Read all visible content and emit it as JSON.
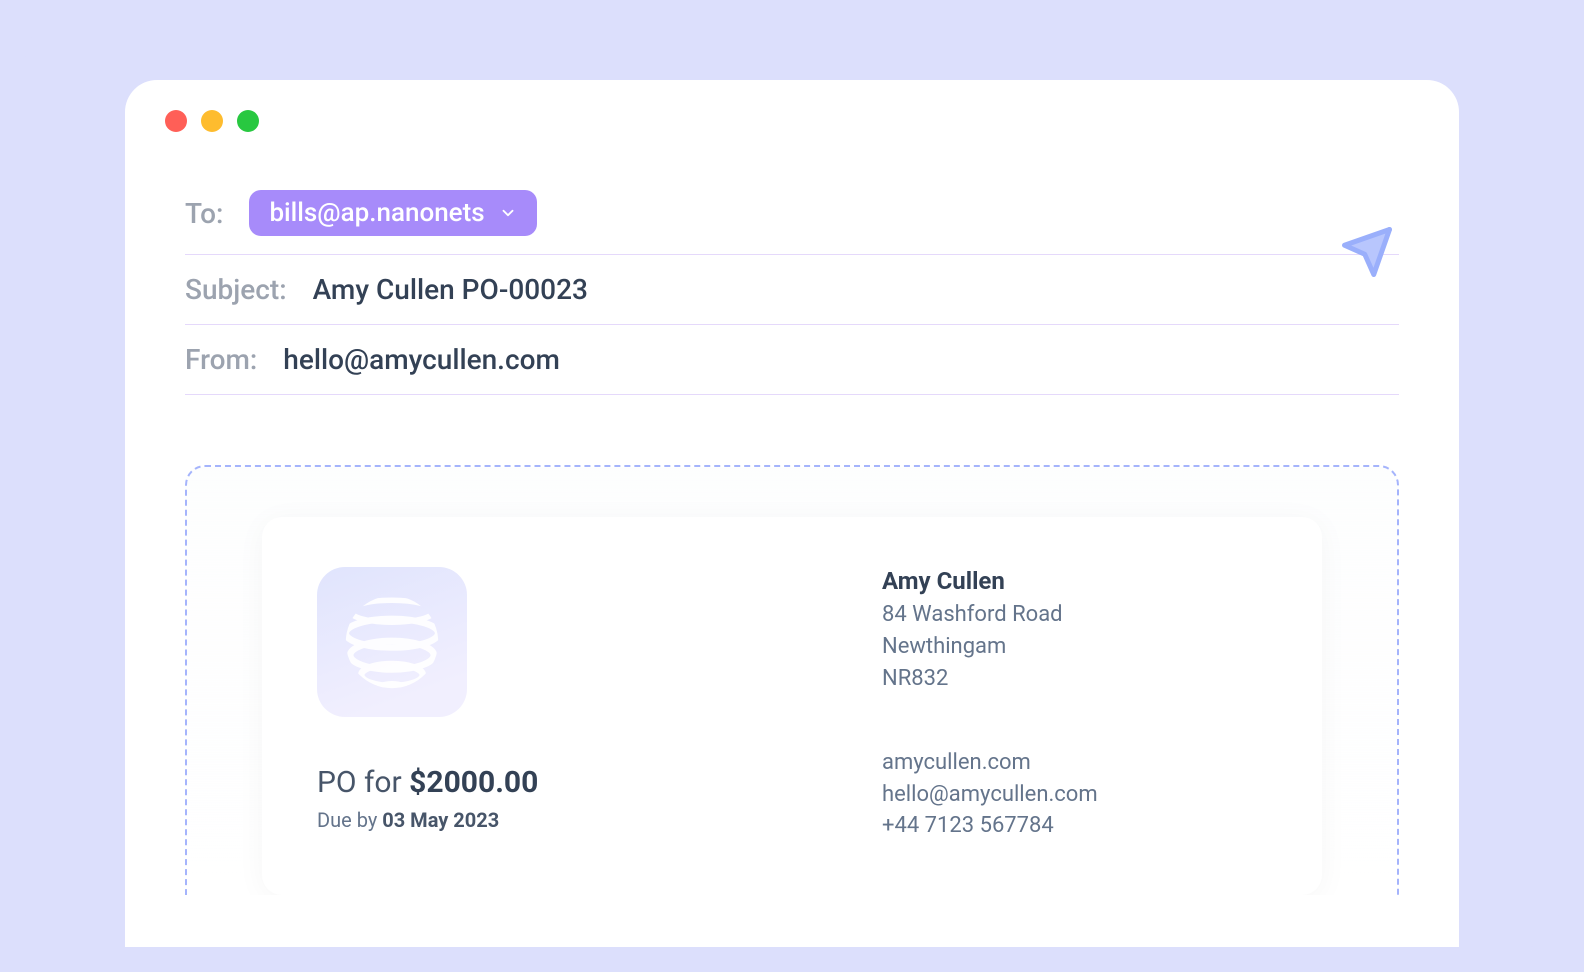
{
  "header": {
    "to_label": "To:",
    "to_value": "bills@ap.nanonets",
    "subject_label": "Subject:",
    "subject_value": "Amy Cullen PO-00023",
    "from_label": "From:",
    "from_value": "hello@amycullen.com"
  },
  "attachment": {
    "po_prefix": "PO for ",
    "po_amount": "$2000.00",
    "due_prefix": "Due by ",
    "due_date": "03 May 2023",
    "recipient_name": "Amy Cullen",
    "address_line1": "84 Washford Road",
    "address_line2": "Newthingam",
    "address_line3": "NR832",
    "website": "amycullen.com",
    "email": "hello@amycullen.com",
    "phone": "+44 7123 567784"
  }
}
